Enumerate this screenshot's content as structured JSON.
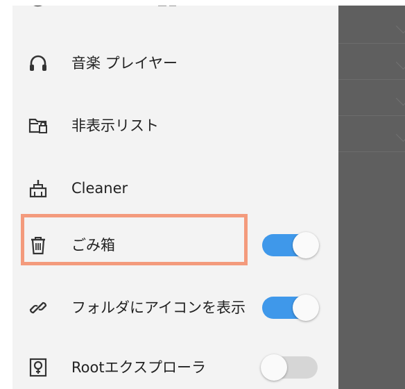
{
  "drawer": {
    "items": [
      {
        "label": "音楽 プレイヤー",
        "icon": "headphones-icon"
      },
      {
        "label": "非表示リスト",
        "icon": "folder-lock-icon"
      },
      {
        "label": "Cleaner",
        "icon": "broom-icon"
      },
      {
        "label": "ごみ箱",
        "icon": "trash-icon",
        "toggle": true,
        "toggle_on": true,
        "highlighted": true
      },
      {
        "label": "フォルダにアイコンを表示",
        "icon": "link-icon",
        "toggle": true,
        "toggle_on": true
      },
      {
        "label": "Rootエクスプローラ",
        "icon": "root-explorer-icon",
        "toggle": true,
        "toggle_on": false
      }
    ]
  },
  "colors": {
    "toggle_on": "#3f98ea",
    "toggle_off": "#d6d6d6",
    "highlight": "#f39a7c",
    "drawer_bg": "#f3f3f3",
    "scrim": "#5f5f5f"
  }
}
